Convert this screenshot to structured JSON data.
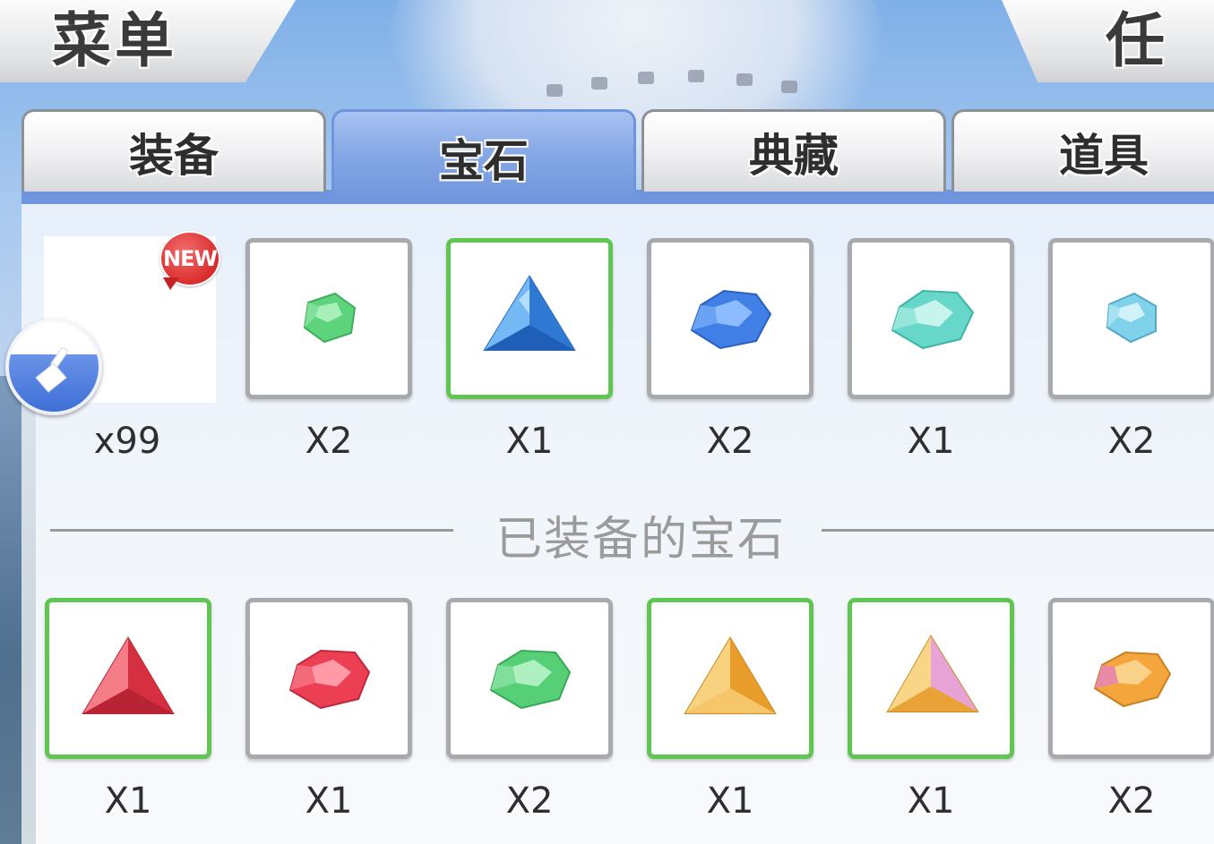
{
  "header": {
    "menu_title": "菜单",
    "quest_title": "任务"
  },
  "tabs": [
    {
      "label": "装备",
      "active": false
    },
    {
      "label": "宝石",
      "active": true
    },
    {
      "label": "典藏",
      "active": false
    },
    {
      "label": "道具",
      "active": false
    }
  ],
  "badge": {
    "new_label": "NEW"
  },
  "inventory": [
    {
      "gem": "none",
      "count": "x99"
    },
    {
      "gem": "green-round",
      "count": "X2"
    },
    {
      "gem": "blue-triangle",
      "count": "X1"
    },
    {
      "gem": "blue-round",
      "count": "X2"
    },
    {
      "gem": "cyan-round",
      "count": "X1"
    },
    {
      "gem": "light-blue-round",
      "count": "X2"
    }
  ],
  "equipped_section": {
    "label": "已装备的宝石"
  },
  "equipped": [
    {
      "gem": "red-triangle",
      "count": "X1"
    },
    {
      "gem": "red-round",
      "count": "X1"
    },
    {
      "gem": "green-round",
      "count": "X2"
    },
    {
      "gem": "yellow-triangle",
      "count": "X1"
    },
    {
      "gem": "yellow-pink-triangle",
      "count": "X1"
    },
    {
      "gem": "orange-round",
      "count": "X2"
    }
  ],
  "colors": {
    "selected_border": "#5fc652",
    "active_tab": "#6f95dc",
    "slot_border": "#a8aaae"
  }
}
